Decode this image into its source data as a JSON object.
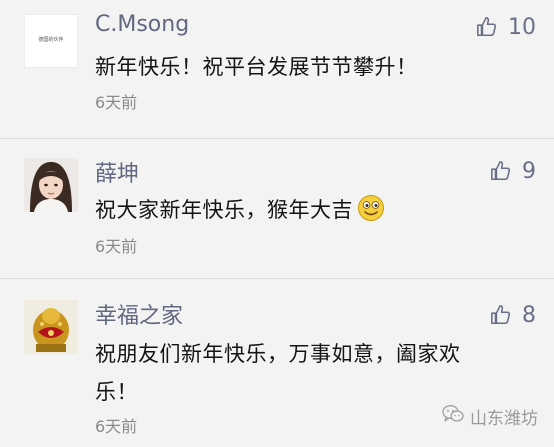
{
  "comments": [
    {
      "username": "C.Msong",
      "likes": "10",
      "text": "新年快乐！祝平台发展节节攀升！",
      "time": "6天前",
      "avatar_caption": "德国的伙伴"
    },
    {
      "username": "薛坤",
      "likes": "9",
      "text": "祝大家新年快乐，猴年大吉",
      "emoji": "smiley-emoji",
      "time": "6天前"
    },
    {
      "username": "幸福之家",
      "likes": "8",
      "text_line1": "祝朋友们新年快乐，万事如意，阖家欢",
      "text_line2": "乐！",
      "time": "6天前"
    }
  ],
  "watermark": {
    "text": "山东潍坊",
    "icon": "wechat-icon"
  },
  "colors": {
    "background": "#f3f3f3",
    "username": "#626880",
    "like_icon": "#6a6f88",
    "text": "#141414",
    "time": "#8a8a8a"
  }
}
